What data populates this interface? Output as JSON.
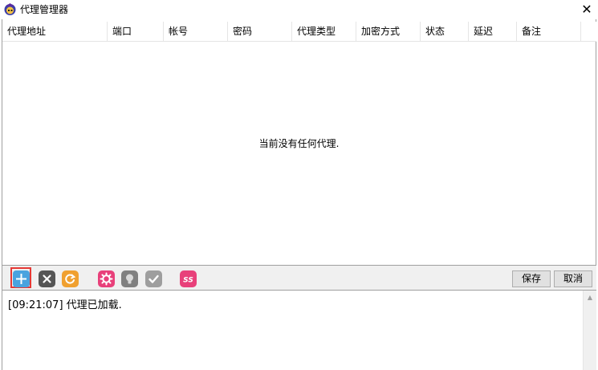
{
  "window": {
    "title": "代理管理器",
    "close_glyph": "✕"
  },
  "table": {
    "columns": [
      "代理地址",
      "端口",
      "帐号",
      "密码",
      "代理类型",
      "加密方式",
      "状态",
      "延迟",
      "备注"
    ],
    "empty_message": "当前没有任何代理."
  },
  "toolbar": {
    "icons": [
      {
        "name": "add-icon",
        "color": "#4aa3df",
        "selected": true
      },
      {
        "name": "delete-icon",
        "color": "#555555"
      },
      {
        "name": "refresh-icon",
        "color": "#f0a030"
      },
      {
        "name": "settings-icon",
        "color": "#e8407a"
      },
      {
        "name": "lightbulb-icon",
        "color": "#808080"
      },
      {
        "name": "check-icon",
        "color": "#9e9e9e"
      },
      {
        "name": "ss-icon",
        "color": "#e8407a",
        "label": "SS"
      }
    ],
    "save_label": "保存",
    "cancel_label": "取消"
  },
  "log": {
    "lines": [
      "[09:21:07]  代理已加载."
    ]
  }
}
